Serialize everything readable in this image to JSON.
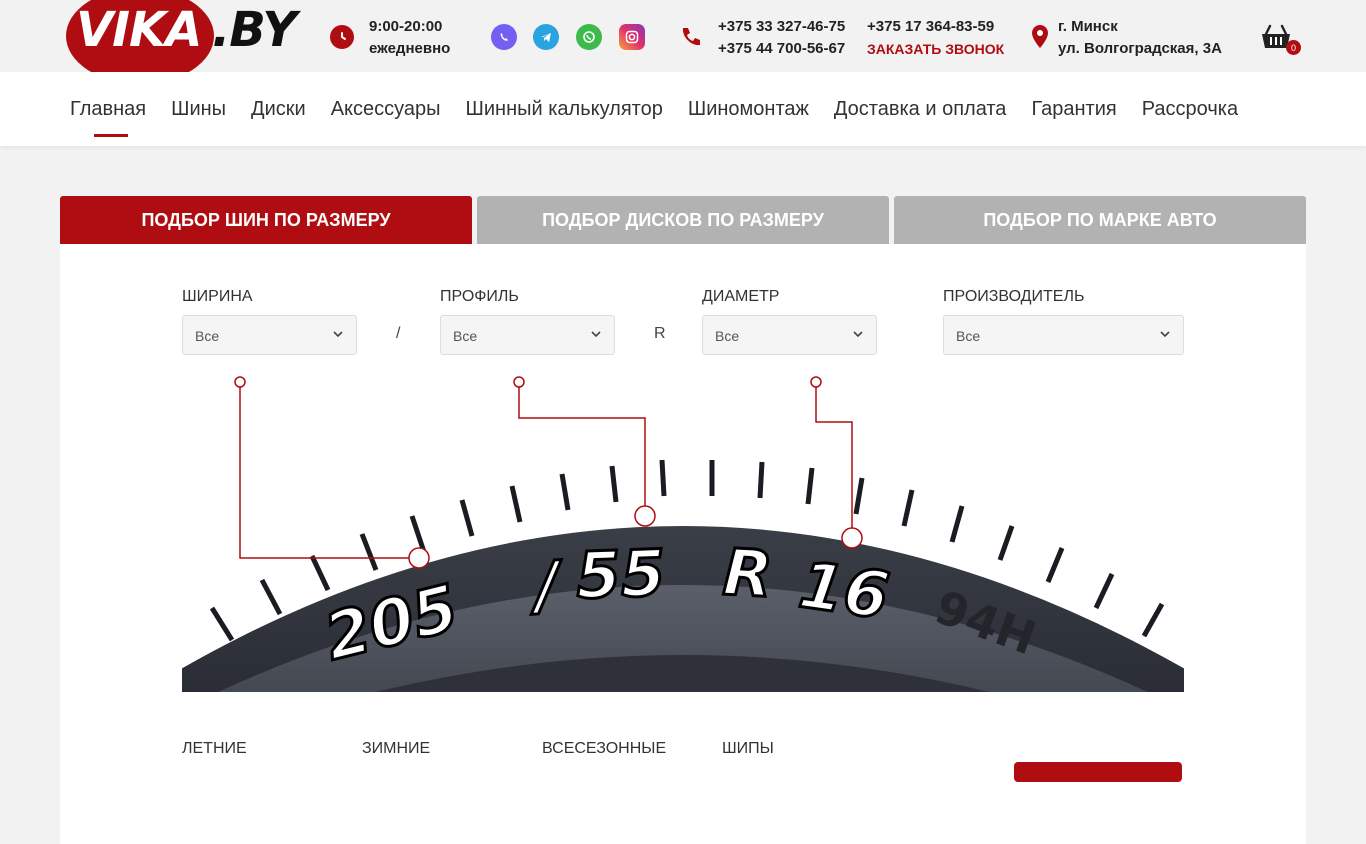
{
  "logo": {
    "main": "VIKA",
    "suffix": ".BY"
  },
  "hours": {
    "time": "9:00-20:00",
    "days": "ежедневно"
  },
  "social": [
    "viber-icon",
    "telegram-icon",
    "whatsapp-icon",
    "instagram-icon"
  ],
  "phones": {
    "col1": [
      "+375 33 327-46-75",
      "+375 44 700-56-67"
    ],
    "col2": "+375 17 364-83-59",
    "callback": "ЗАКАЗАТЬ ЗВОНОК"
  },
  "address": {
    "city": "г. Минск",
    "street": "ул. Волгоградская, 3А"
  },
  "cart": {
    "count": "0"
  },
  "nav": [
    {
      "label": "Главная",
      "active": true
    },
    {
      "label": "Шины"
    },
    {
      "label": "Диски"
    },
    {
      "label": "Аксессуары"
    },
    {
      "label": "Шинный калькулятор"
    },
    {
      "label": "Шиномонтаж"
    },
    {
      "label": "Доставка и оплата"
    },
    {
      "label": "Гарантия"
    },
    {
      "label": "Рассрочка"
    }
  ],
  "tabs": [
    "ПОДБОР ШИН ПО РАЗМЕРУ",
    "ПОДБОР ДИСКОВ ПО РАЗМЕРУ",
    "ПОДБОР ПО МАРКЕ АВТО"
  ],
  "filters": {
    "width": {
      "label": "ШИРИНА",
      "value": "Все"
    },
    "profile": {
      "label": "ПРОФИЛЬ",
      "value": "Все"
    },
    "diameter": {
      "label": "ДИАМЕТР",
      "value": "Все"
    },
    "brand": {
      "label": "ПРОИЗВОДИТЕЛЬ",
      "value": "Все"
    },
    "sep1": "/",
    "sep2": "R"
  },
  "tire": {
    "size_a": "205",
    "slash": "/",
    "size_b": "55",
    "r": "R",
    "size_c": "16",
    "index": "94H"
  },
  "seasons": [
    "ЛЕТНИЕ",
    "ЗИМНИЕ",
    "ВСЕСЕЗОННЫЕ",
    "ШИПЫ"
  ],
  "colors": {
    "accent": "#b00d12",
    "tab_inactive": "#b2b2b2"
  }
}
